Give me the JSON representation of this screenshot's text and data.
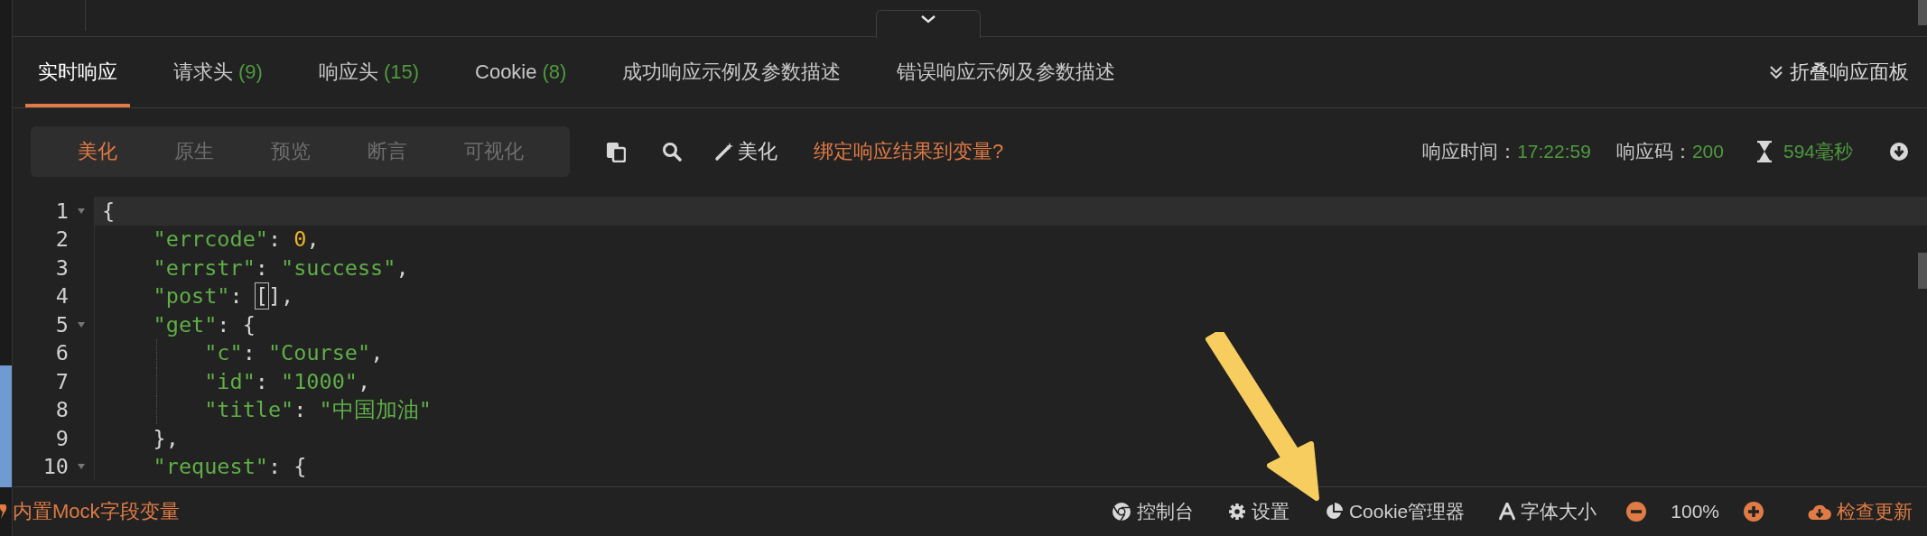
{
  "tabs": [
    {
      "label": "实时响应",
      "selected": true
    },
    {
      "label": "请求头",
      "count": "(9)",
      "selected": false
    },
    {
      "label": "响应头",
      "count": "(15)",
      "selected": false
    },
    {
      "label": "Cookie",
      "count": "(8)",
      "selected": false
    },
    {
      "label": "成功响应示例及参数描述",
      "selected": false
    },
    {
      "label": "错误响应示例及参数描述",
      "selected": false
    }
  ],
  "collapse_panel": "折叠响应面板",
  "view_modes": [
    {
      "label": "美化",
      "selected": true
    },
    {
      "label": "原生",
      "selected": false
    },
    {
      "label": "预览",
      "selected": false
    },
    {
      "label": "断言",
      "selected": false
    },
    {
      "label": "可视化",
      "selected": false
    }
  ],
  "beautify_button": "美化",
  "bind_link": "绑定响应结果到变量?",
  "response_time": {
    "label": "响应时间：",
    "value": "17:22:59"
  },
  "response_code": {
    "label": "响应码：",
    "value": "200"
  },
  "duration": "594毫秒",
  "code_lines": [
    {
      "number": "1",
      "foldable": true,
      "active": true,
      "tokens": [
        {
          "kind": "punct",
          "text": "{"
        }
      ]
    },
    {
      "number": "2",
      "foldable": false,
      "active": false,
      "tokens": [
        {
          "kind": "string",
          "text": "    \"errcode\""
        },
        {
          "kind": "punct",
          "text": ": "
        },
        {
          "kind": "number",
          "text": "0"
        },
        {
          "kind": "punct",
          "text": ","
        }
      ]
    },
    {
      "number": "3",
      "foldable": false,
      "active": false,
      "tokens": [
        {
          "kind": "string",
          "text": "    \"errstr\""
        },
        {
          "kind": "punct",
          "text": ": "
        },
        {
          "kind": "string",
          "text": "\"success\""
        },
        {
          "kind": "punct",
          "text": ","
        }
      ]
    },
    {
      "number": "4",
      "foldable": false,
      "active": false,
      "tokens": [
        {
          "kind": "string",
          "text": "    \"post\""
        },
        {
          "kind": "punct",
          "text": ": "
        },
        {
          "kind": "match",
          "text": "["
        },
        {
          "kind": "punct",
          "text": "]"
        },
        {
          "kind": "punct",
          "text": ","
        }
      ]
    },
    {
      "number": "5",
      "foldable": true,
      "active": false,
      "tokens": [
        {
          "kind": "string",
          "text": "    \"get\""
        },
        {
          "kind": "punct",
          "text": ": {"
        }
      ]
    },
    {
      "number": "6",
      "foldable": false,
      "active": false,
      "guide": true,
      "tokens": [
        {
          "kind": "string",
          "text": "        \"c\""
        },
        {
          "kind": "punct",
          "text": ": "
        },
        {
          "kind": "string",
          "text": "\"Course\""
        },
        {
          "kind": "punct",
          "text": ","
        }
      ]
    },
    {
      "number": "7",
      "foldable": false,
      "active": false,
      "guide": true,
      "tokens": [
        {
          "kind": "string",
          "text": "        \"id\""
        },
        {
          "kind": "punct",
          "text": ": "
        },
        {
          "kind": "string",
          "text": "\"1000\""
        },
        {
          "kind": "punct",
          "text": ","
        }
      ]
    },
    {
      "number": "8",
      "foldable": false,
      "active": false,
      "guide": true,
      "tokens": [
        {
          "kind": "string",
          "text": "        \"title\""
        },
        {
          "kind": "punct",
          "text": ": "
        },
        {
          "kind": "string",
          "text": "\"中国加油\""
        }
      ]
    },
    {
      "number": "9",
      "foldable": false,
      "active": false,
      "tokens": [
        {
          "kind": "punct",
          "text": "    },"
        }
      ]
    },
    {
      "number": "10",
      "foldable": true,
      "active": false,
      "tokens": [
        {
          "kind": "string",
          "text": "    \"request\""
        },
        {
          "kind": "punct",
          "text": ": {"
        }
      ]
    }
  ],
  "status_left": "内置Mock字段变量",
  "status_items": [
    {
      "kind": "console",
      "label": "控制台"
    },
    {
      "kind": "settings",
      "label": "设置"
    },
    {
      "kind": "cookies",
      "label": "Cookie管理器"
    },
    {
      "kind": "font",
      "label": "字体大小"
    },
    {
      "kind": "zoom-out"
    },
    {
      "kind": "zoom-value",
      "label": "100%"
    },
    {
      "kind": "zoom-in"
    },
    {
      "kind": "update",
      "label": "检查更新"
    }
  ]
}
